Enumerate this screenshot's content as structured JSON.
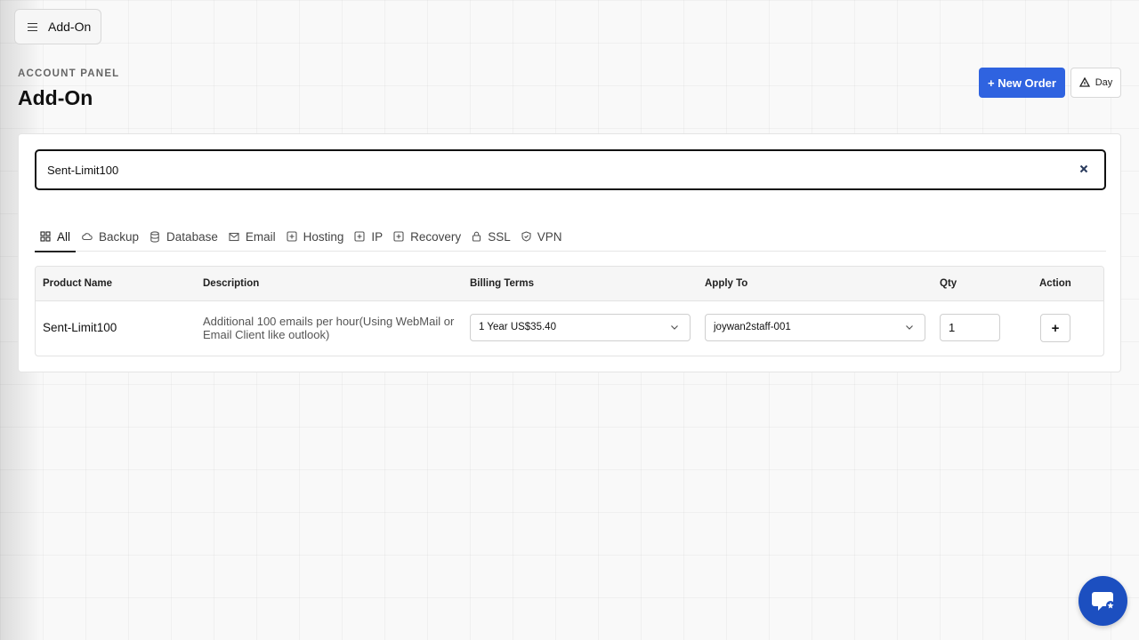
{
  "header": {
    "menu_label": "Add-On",
    "eyebrow": "ACCOUNT PANEL",
    "title": "Add-On",
    "new_order_label": "+ New Order",
    "theme_label": "Day"
  },
  "search": {
    "value": "Sent-Limit100",
    "placeholder": ""
  },
  "tabs": [
    {
      "label": "All",
      "icon": "grid-icon"
    },
    {
      "label": "Backup",
      "icon": "cloud-icon"
    },
    {
      "label": "Database",
      "icon": "database-icon"
    },
    {
      "label": "Email",
      "icon": "mail-icon"
    },
    {
      "label": "Hosting",
      "icon": "plus-square-icon"
    },
    {
      "label": "IP",
      "icon": "plus-square-icon"
    },
    {
      "label": "Recovery",
      "icon": "plus-square-icon"
    },
    {
      "label": "SSL",
      "icon": "lock-icon"
    },
    {
      "label": "VPN",
      "icon": "shield-icon"
    }
  ],
  "active_tab": "All",
  "table": {
    "columns": [
      "Product Name",
      "Description",
      "Billing Terms",
      "Apply To",
      "Qty",
      "Action"
    ],
    "rows": [
      {
        "product": "Sent-Limit100",
        "description": "Additional 100 emails per hour(Using WebMail or Email Client like outlook)",
        "billing": "1 Year US$35.40",
        "apply_to": "joywan2staff-001",
        "qty": "1",
        "action": "+"
      }
    ]
  },
  "colors": {
    "primary": "#2f63e0",
    "chat": "#1c4fc0"
  },
  "chat_icon": "chat-support-icon"
}
